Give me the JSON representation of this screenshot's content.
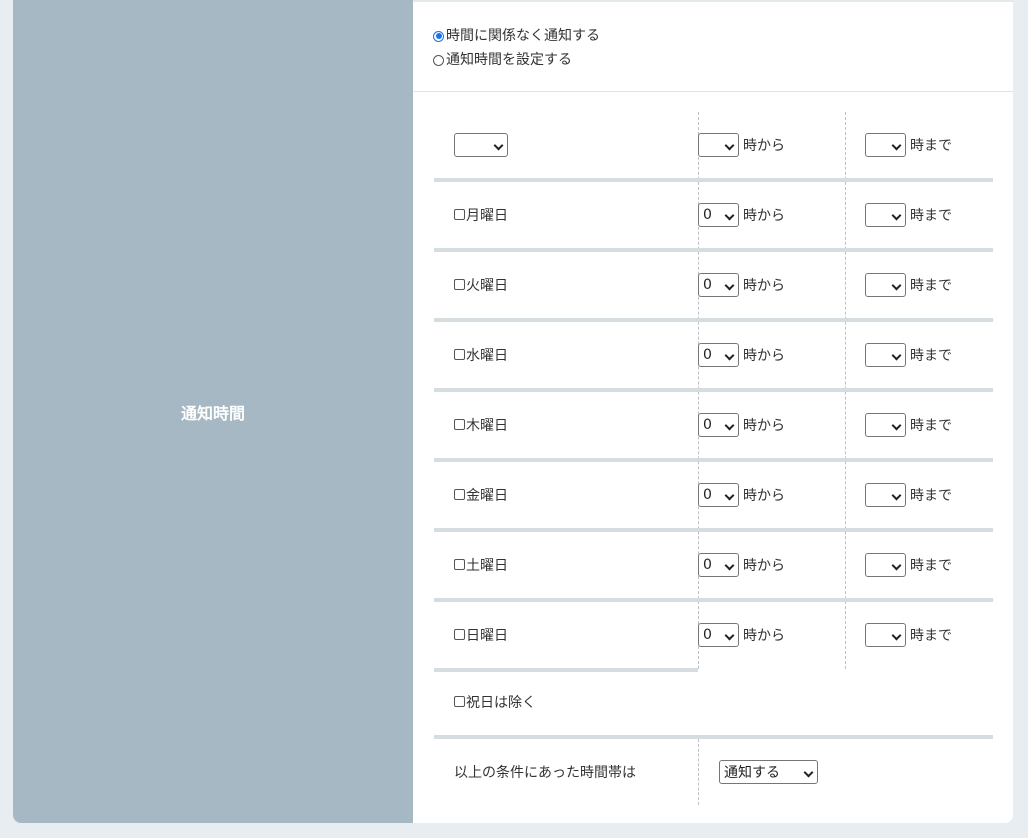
{
  "section": {
    "label": "通知時間"
  },
  "radio_options": [
    {
      "label": "時間に関係なく通知する",
      "checked": true
    },
    {
      "label": "通知時間を設定する",
      "checked": false
    }
  ],
  "header_row": {
    "day_select_value": "",
    "from_value": "",
    "from_suffix": "時から",
    "to_value": "",
    "to_suffix": "時まで"
  },
  "days": [
    {
      "label": "月曜日",
      "checked": false,
      "from_value": "0",
      "from_suffix": "時から",
      "to_value": "",
      "to_suffix": "時まで"
    },
    {
      "label": "火曜日",
      "checked": false,
      "from_value": "0",
      "from_suffix": "時から",
      "to_value": "",
      "to_suffix": "時まで"
    },
    {
      "label": "水曜日",
      "checked": false,
      "from_value": "0",
      "from_suffix": "時から",
      "to_value": "",
      "to_suffix": "時まで"
    },
    {
      "label": "木曜日",
      "checked": false,
      "from_value": "0",
      "from_suffix": "時から",
      "to_value": "",
      "to_suffix": "時まで"
    },
    {
      "label": "金曜日",
      "checked": false,
      "from_value": "0",
      "from_suffix": "時から",
      "to_value": "",
      "to_suffix": "時まで"
    },
    {
      "label": "土曜日",
      "checked": false,
      "from_value": "0",
      "from_suffix": "時から",
      "to_value": "",
      "to_suffix": "時まで"
    },
    {
      "label": "日曜日",
      "checked": false,
      "from_value": "0",
      "from_suffix": "時から",
      "to_value": "",
      "to_suffix": "時まで"
    }
  ],
  "holiday": {
    "label": "祝日は除く",
    "checked": false
  },
  "condition": {
    "label": "以上の条件にあった時間帯は",
    "value": "通知する"
  },
  "colors": {
    "label_bg": "#a6b8c3",
    "page_bg": "#e7edf1",
    "radio_accent": "#1a73e8"
  }
}
